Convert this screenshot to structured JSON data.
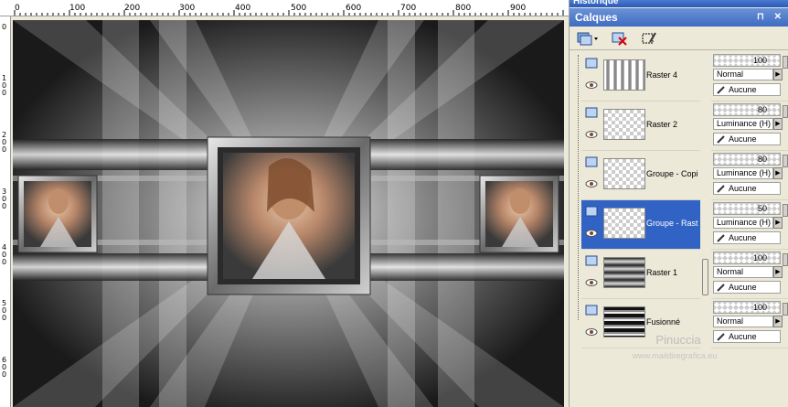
{
  "panels": {
    "history_title": "Historique",
    "layers_title": "Calques"
  },
  "ruler": {
    "top_labels": [
      "0",
      "100",
      "200",
      "300",
      "400",
      "500",
      "600",
      "700",
      "800",
      "900"
    ],
    "left_labels": [
      "0",
      "1 0 0",
      "2 0 0",
      "3 0 0",
      "4 0 0",
      "5 0 0",
      "6 0 0"
    ]
  },
  "toolbar": {
    "new_layer_icon": "new-layer-icon",
    "delete_icon": "delete-layer-icon",
    "edit_selection_icon": "edit-selection-icon"
  },
  "layers": [
    {
      "name": "Raster 4",
      "opacity": "100",
      "blend": "Normal",
      "mask": "Aucune",
      "selected": false
    },
    {
      "name": "Raster 2",
      "opacity": "80",
      "blend": "Luminance (H)",
      "mask": "Aucune",
      "selected": false
    },
    {
      "name": "Groupe - Copi",
      "opacity": "80",
      "blend": "Luminance (H)",
      "mask": "Aucune",
      "selected": false
    },
    {
      "name": "Groupe - Rast",
      "opacity": "50",
      "blend": "Luminance (H)",
      "mask": "Aucune",
      "selected": true
    },
    {
      "name": "Raster 1",
      "opacity": "100",
      "blend": "Normal",
      "mask": "Aucune",
      "selected": false
    },
    {
      "name": "Fusionné",
      "opacity": "100",
      "blend": "Normal",
      "mask": "Aucune",
      "selected": false
    }
  ],
  "watermark": {
    "name": "Pinuccia",
    "url": "www.maildiregrafica.eu"
  },
  "colors": {
    "selection": "#3163c5",
    "titlebar": "#3e6bc2"
  }
}
